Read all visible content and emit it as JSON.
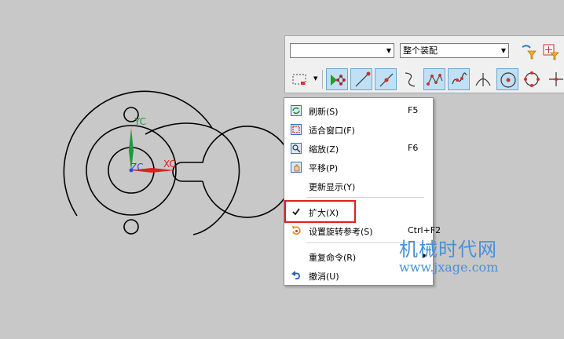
{
  "viewport": {
    "axis_labels": {
      "yc": "YC",
      "xc": "XC",
      "zc": "ZC"
    },
    "colors": {
      "x_axis": "#e02020",
      "y_axis": "#1e9a3a",
      "z_axis": "#2a4fe0",
      "geometry": "#000000"
    }
  },
  "toolbar": {
    "filter_combo": {
      "value": ""
    },
    "scope_combo": {
      "value": "整个装配"
    },
    "buttons": [
      {
        "icon": "filter-funnel-icon"
      },
      {
        "icon": "select-filter-box-icon"
      },
      {
        "icon": "rectangle-select-icon"
      },
      {
        "icon": "snap-all-icon",
        "active": true
      },
      {
        "icon": "snap-endpoint-icon",
        "active": true
      },
      {
        "icon": "snap-midpoint-icon",
        "active": true
      },
      {
        "icon": "snap-control-point-icon"
      },
      {
        "icon": "snap-curve-point-icon",
        "active": true
      },
      {
        "icon": "snap-curve-icon",
        "active": true
      },
      {
        "icon": "snap-intersection-icon"
      },
      {
        "icon": "snap-arc-center-icon",
        "active": true
      },
      {
        "icon": "snap-quadrant-icon"
      },
      {
        "icon": "snap-crosshair-icon"
      }
    ]
  },
  "context_menu": {
    "items": [
      {
        "label": "刷新(S)",
        "shortcut": "F5",
        "icon": "refresh-icon"
      },
      {
        "label": "适合窗口(F)",
        "shortcut": "",
        "icon": "fit-window-icon"
      },
      {
        "label": "缩放(Z)",
        "shortcut": "F6",
        "icon": "zoom-icon"
      },
      {
        "label": "平移(P)",
        "shortcut": "",
        "icon": "pan-icon"
      },
      {
        "label": "更新显示(Y)",
        "shortcut": "",
        "icon": ""
      },
      {
        "label": "扩大(X)",
        "shortcut": "",
        "icon": "checkmark-icon",
        "checked": true
      },
      {
        "label": "设置旋转参考(S)",
        "shortcut": "Ctrl+F2",
        "icon": "rotate-reference-icon"
      },
      {
        "label": "重复命令(R)",
        "shortcut": "",
        "icon": "",
        "submenu": true
      },
      {
        "label": "撤消(U)",
        "shortcut": "",
        "icon": "undo-icon"
      }
    ],
    "highlight_color": "#e02020"
  },
  "watermark": {
    "line1": "机械时代网",
    "line2": "www.jxage.com"
  }
}
